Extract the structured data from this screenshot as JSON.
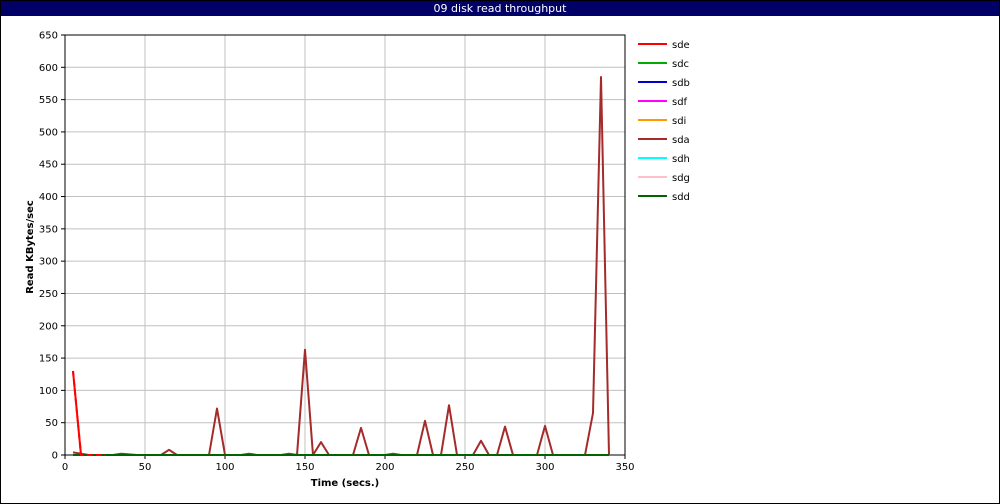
{
  "window": {
    "title": "09 disk read throughput"
  },
  "chart_data": {
    "type": "line",
    "title": "09 disk read throughput",
    "xlabel": "Time (secs.)",
    "ylabel": "Read KBytes/sec",
    "xlim": [
      0,
      350
    ],
    "ylim": [
      0,
      650
    ],
    "xticks": [
      0,
      50,
      100,
      150,
      200,
      250,
      300,
      350
    ],
    "yticks": [
      0,
      50,
      100,
      150,
      200,
      250,
      300,
      350,
      400,
      450,
      500,
      550,
      600,
      650
    ],
    "grid": true,
    "legend_position": "right",
    "series": [
      {
        "name": "sde",
        "color": "#ff0000",
        "x": [
          5,
          10,
          15,
          20,
          25
        ],
        "y": [
          130,
          0,
          0,
          0,
          0
        ]
      },
      {
        "name": "sdc",
        "color": "#00aa00",
        "x": [
          5,
          10,
          340
        ],
        "y": [
          0,
          0,
          0
        ]
      },
      {
        "name": "sdb",
        "color": "#0000cc",
        "x": [
          5,
          10,
          340
        ],
        "y": [
          0,
          0,
          0
        ]
      },
      {
        "name": "sdf",
        "color": "#ff00ff",
        "x": [
          5,
          10,
          340
        ],
        "y": [
          0,
          0,
          0
        ]
      },
      {
        "name": "sdi",
        "color": "#ff9900",
        "x": [
          5,
          10,
          340
        ],
        "y": [
          0,
          0,
          0
        ]
      },
      {
        "name": "sda",
        "color": "#a52a2a",
        "x": [
          5,
          10,
          15,
          20,
          25,
          30,
          35,
          40,
          45,
          50,
          55,
          60,
          65,
          70,
          75,
          80,
          85,
          90,
          95,
          100,
          105,
          110,
          115,
          120,
          125,
          130,
          135,
          140,
          145,
          150,
          155,
          160,
          165,
          170,
          175,
          180,
          185,
          190,
          195,
          200,
          205,
          210,
          215,
          220,
          225,
          230,
          235,
          240,
          245,
          250,
          255,
          260,
          265,
          270,
          275,
          280,
          285,
          290,
          295,
          300,
          305,
          310,
          315,
          320,
          325,
          330,
          335,
          340
        ],
        "y": [
          4,
          2,
          0,
          0,
          0,
          0,
          2,
          1,
          0,
          0,
          0,
          0,
          8,
          0,
          0,
          0,
          0,
          0,
          72,
          0,
          0,
          0,
          2,
          0,
          0,
          0,
          0,
          2,
          0,
          163,
          0,
          20,
          0,
          0,
          0,
          0,
          42,
          0,
          0,
          0,
          2,
          0,
          0,
          0,
          53,
          0,
          0,
          77,
          0,
          0,
          0,
          22,
          0,
          0,
          44,
          0,
          0,
          0,
          0,
          45,
          0,
          0,
          0,
          0,
          0,
          65,
          585,
          0
        ]
      },
      {
        "name": "sdh",
        "color": "#00ffff",
        "x": [
          5,
          10,
          340
        ],
        "y": [
          0,
          0,
          0
        ]
      },
      {
        "name": "sdg",
        "color": "#ffc0cb",
        "x": [
          5,
          10,
          340
        ],
        "y": [
          0,
          0,
          0
        ]
      },
      {
        "name": "sdd",
        "color": "#006400",
        "x": [
          5,
          10,
          340
        ],
        "y": [
          0,
          0,
          0
        ]
      }
    ]
  }
}
